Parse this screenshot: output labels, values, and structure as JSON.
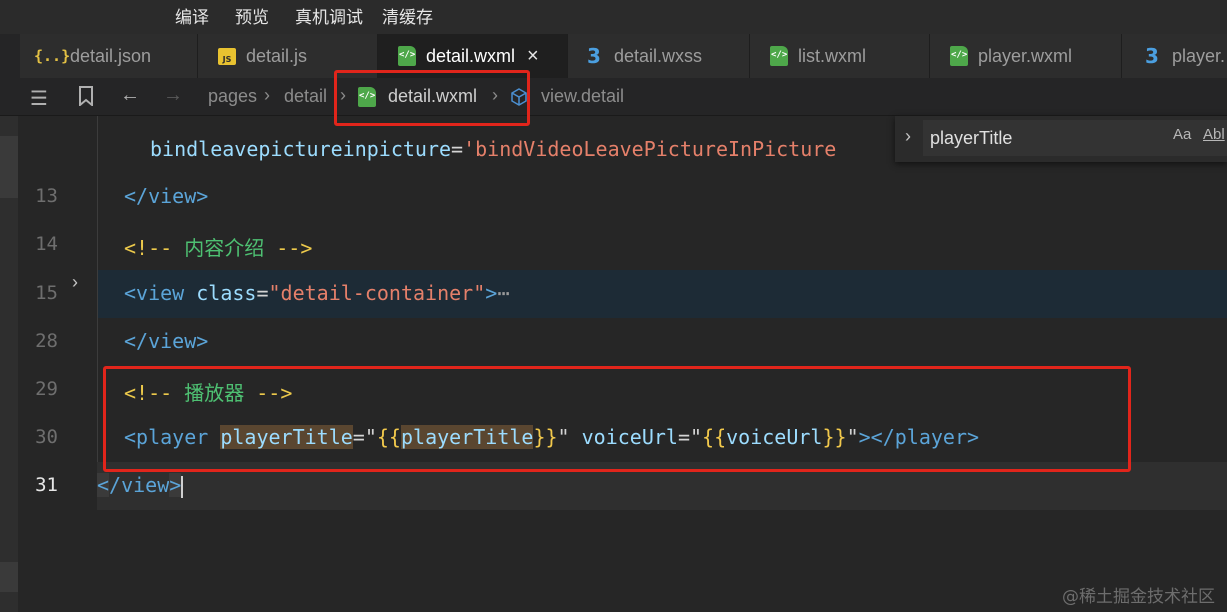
{
  "menu": {
    "items": [
      "编译",
      "预览",
      "真机调试",
      "清缓存"
    ]
  },
  "tabs": [
    {
      "label": "detail.json",
      "icon": "json-file-icon"
    },
    {
      "label": "detail.js",
      "icon": "js-file-icon"
    },
    {
      "label": "detail.wxml",
      "icon": "wxml-file-icon",
      "active": true,
      "close": "×"
    },
    {
      "label": "detail.wxss",
      "icon": "wxss-file-icon"
    },
    {
      "label": "list.wxml",
      "icon": "wxml-file-icon"
    },
    {
      "label": "player.wxml",
      "icon": "wxml-file-icon"
    },
    {
      "label": "player.",
      "icon": "wxss-file-icon"
    }
  ],
  "breadcrumb": {
    "items": [
      "pages",
      "detail",
      "detail.wxml",
      "view.detail"
    ]
  },
  "find": {
    "value": "playerTitle",
    "match_case": "Aa",
    "whole_word": "Abl"
  },
  "gutter": {
    "lines": [
      "13",
      "14",
      "15",
      "28",
      "29",
      "30",
      "31"
    ]
  },
  "code": {
    "line_cut": {
      "a": "bindleavepictureinpicture",
      "b": "=",
      "c": "'bindVideoLeavePictureInPicture"
    },
    "line13": {
      "a": "</view>"
    },
    "line14": {
      "a": "<!--",
      "b": " 内容介绍 ",
      "c": "-->"
    },
    "line15": {
      "a": "<view",
      "b": " class",
      "c": "=",
      "d": "\"detail-container\"",
      "e": ">",
      "f": "⋯"
    },
    "line28": {
      "a": "</view>"
    },
    "line29": {
      "a": "<!--",
      "b": " 播放器 ",
      "c": "-->"
    },
    "line30": {
      "a": "<player",
      "b": "playerTitle",
      "c": "=\"",
      "d": "{{",
      "e": "playerTitle",
      "f": "}}",
      "g": "\"",
      "h": " voiceUrl",
      "i": "=\"",
      "j": "{{",
      "k": "voiceUrl",
      "l": "}}",
      "m": "\"",
      "n": "></player>"
    },
    "line31": {
      "a": "<",
      "b": "/view",
      "c": ">"
    }
  },
  "watermark": "@稀土掘金技术社区",
  "colors": {
    "highlight_box": "#e1251b",
    "accent_tag": "#5ba4d8",
    "string": "#e5806a"
  }
}
